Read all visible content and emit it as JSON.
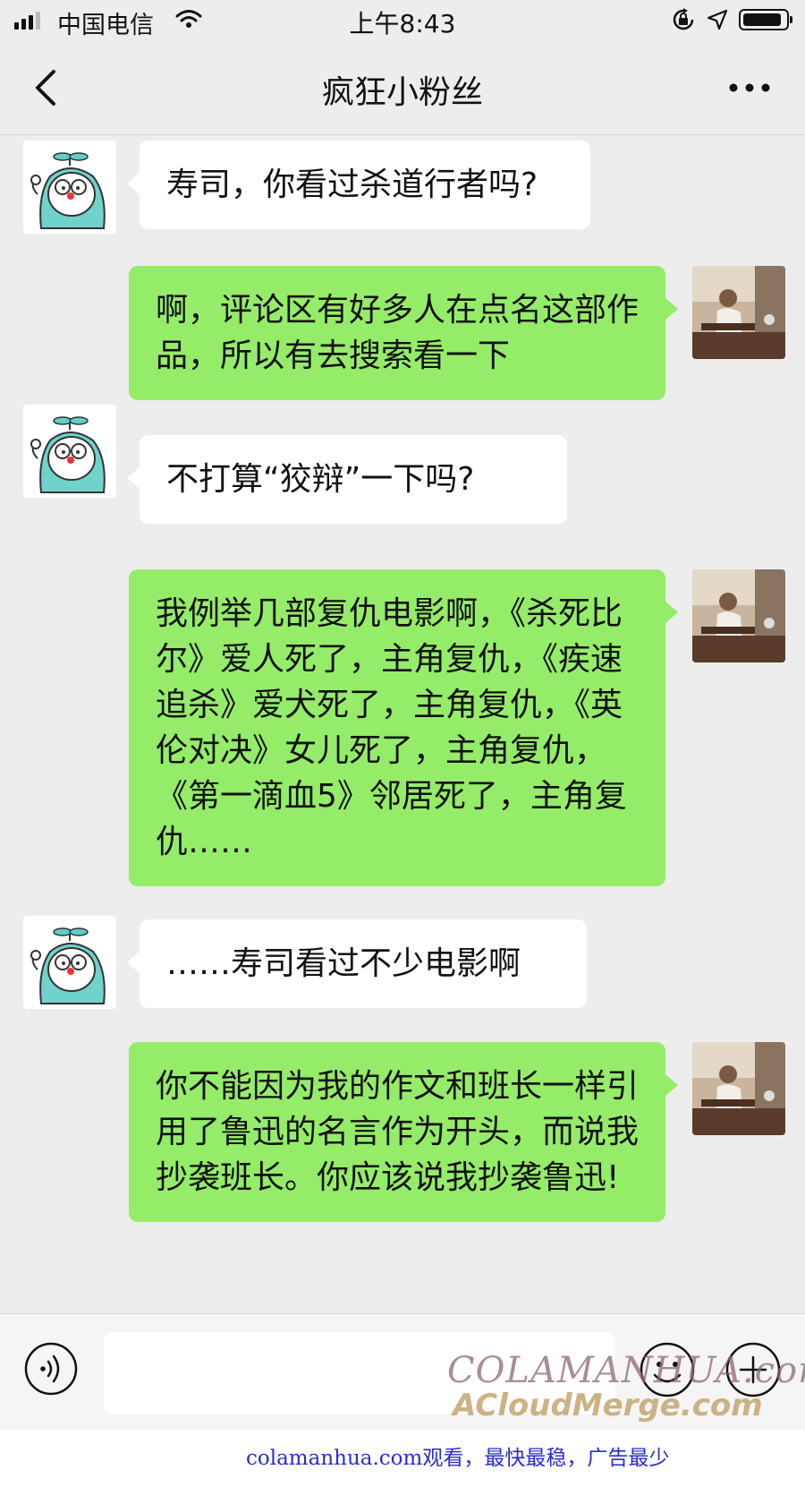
{
  "status_bar": {
    "carrier": "中国电信",
    "time": "上午8:43",
    "wifi_icon": "wifi-icon",
    "rotation_lock_icon": "rotation-lock-icon",
    "location_icon": "location-arrow-icon",
    "battery_icon": "battery-icon"
  },
  "nav": {
    "title": "疯狂小粉丝",
    "back_icon": "chevron-left-icon",
    "more_icon": "more-dots-icon"
  },
  "messages": [
    {
      "side": "in",
      "text": "寿司，你看过杀道行者吗?"
    },
    {
      "side": "out",
      "text": "啊，评论区有好多人在点名这部作品，所以有去搜索看一下"
    },
    {
      "side": "in",
      "text": "不打算“狡辩”一下吗?"
    },
    {
      "side": "out",
      "text": "我例举几部复仇电影啊，《杀死比尔》爱人死了，主角复仇，《疾速追杀》爱犬死了，主角复仇，《英伦对决》女儿死了，主角复仇，《第一滴血5》邻居死了，主角复仇……"
    },
    {
      "side": "in",
      "text": "……寿司看过不少电影啊"
    },
    {
      "side": "out",
      "text": "你不能因为我的作文和班长一样引用了鲁迅的名言作为开头，而说我抄袭班长。你应该说我抄袭鲁迅!"
    }
  ],
  "input_bar": {
    "value": "",
    "voice_icon": "voice-icon",
    "emoji_icon": "emoji-icon",
    "plus_icon": "plus-circle-icon"
  },
  "watermark": {
    "line1": "COLAMANHUA.com",
    "line2": "ACloudMerge.com"
  },
  "footer": {
    "text": "colamanhua.com观看，最快最稳，广告最少"
  },
  "colors": {
    "background": "#ededed",
    "bubble_in": "#ffffff",
    "bubble_out": "#95ec69",
    "footer_link": "#2b2bd4"
  }
}
